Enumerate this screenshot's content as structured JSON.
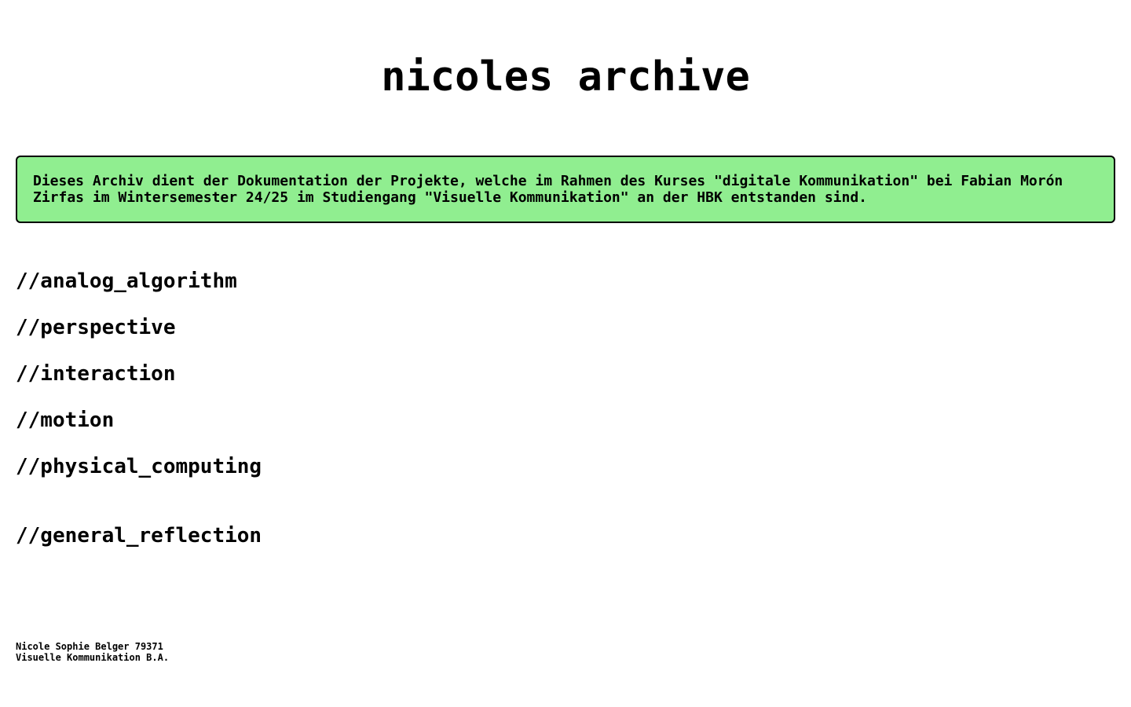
{
  "header": {
    "title": "nicoles archive"
  },
  "intro": {
    "line1": "Dieses Archiv dient der Dokumentation der Projekte, welche im Rahmen des Kurses \"digitale Kommunikation\" bei Fabian Morón",
    "line2": "Zirfas im Wintersemester 24/25 im Studiengang \"Visuelle Kommunikation\" an der HBK entstanden sind.",
    "background_color": "#90ee90"
  },
  "nav": {
    "items": [
      {
        "label": "//analog_algorithm"
      },
      {
        "label": "//perspective"
      },
      {
        "label": "//interaction"
      },
      {
        "label": "//motion"
      },
      {
        "label": "//physical_computing"
      },
      {
        "label": "//general_reflection"
      }
    ]
  },
  "footer": {
    "name_line": "Nicole Sophie Belger 79371",
    "program_line": "Visuelle Kommunikation B.A."
  }
}
